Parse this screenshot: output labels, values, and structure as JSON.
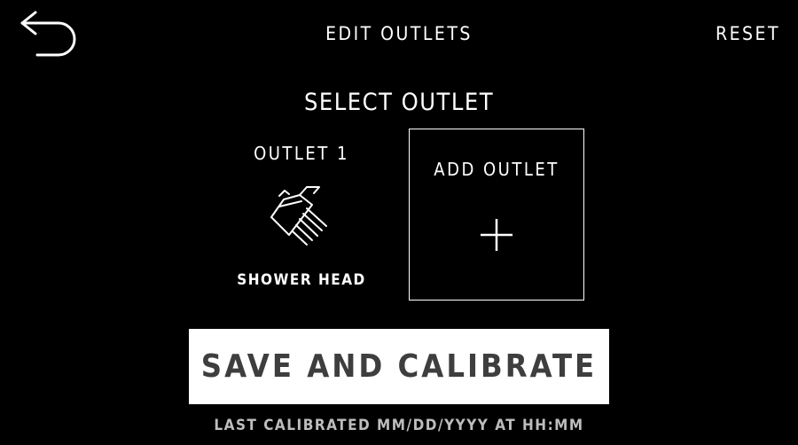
{
  "header": {
    "back_icon": "back-arrow-icon",
    "title": "EDIT OUTLETS",
    "reset_label": "RESET"
  },
  "main": {
    "section_title": "SELECT OUTLET",
    "outlets": [
      {
        "name": "OUTLET 1",
        "icon": "shower-head-icon",
        "type": "SHOWER HEAD"
      }
    ],
    "add_outlet": {
      "label": "ADD OUTLET",
      "icon": "plus-icon"
    }
  },
  "footer": {
    "save_label": "SAVE AND CALIBRATE",
    "last_calibrated": "LAST CALIBRATED MM/DD/YYYY AT HH:MM"
  },
  "colors": {
    "background": "#000000",
    "foreground": "#ffffff",
    "button_text": "#3e3e3e",
    "muted_text": "#bdbdbd"
  }
}
